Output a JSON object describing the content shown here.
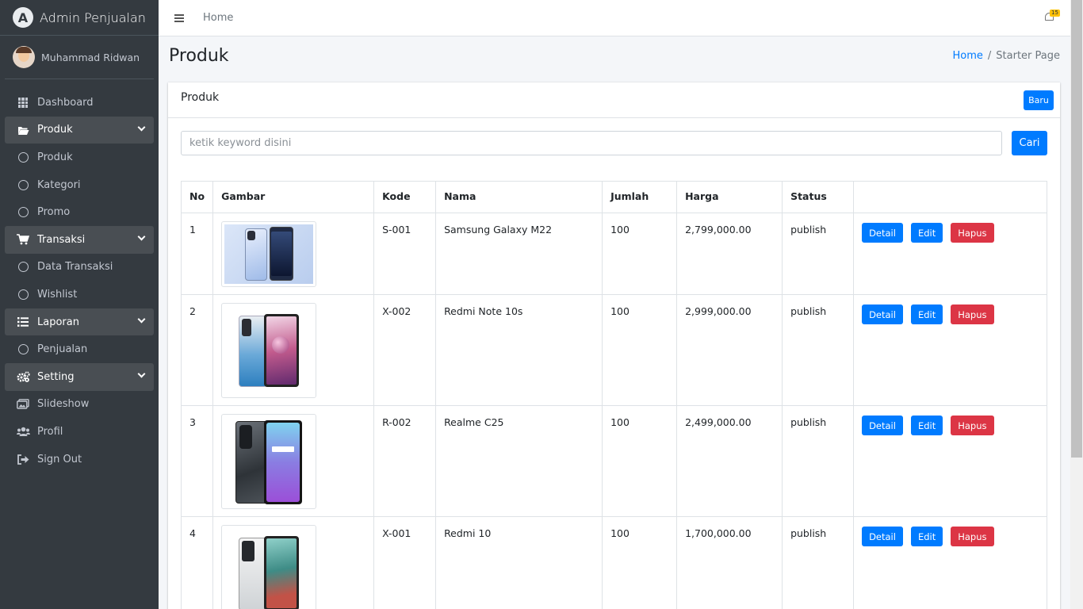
{
  "brand": {
    "name": "Admin Penjualan",
    "logo_letter": "A"
  },
  "user": {
    "name": "Muhammad Ridwan"
  },
  "sidebar": {
    "items": [
      {
        "label": "Dashboard",
        "icon": "grid-icon",
        "active": false,
        "expandable": false
      },
      {
        "label": "Produk",
        "icon": "folder-open-icon",
        "active": true,
        "expandable": true
      },
      {
        "label": "Produk",
        "icon": "circle-icon",
        "active": false,
        "expandable": false
      },
      {
        "label": "Kategori",
        "icon": "circle-icon",
        "active": false,
        "expandable": false
      },
      {
        "label": "Promo",
        "icon": "circle-icon",
        "active": false,
        "expandable": false
      },
      {
        "label": "Transaksi",
        "icon": "cart-icon",
        "active": true,
        "expandable": true
      },
      {
        "label": "Data Transaksi",
        "icon": "circle-icon",
        "active": false,
        "expandable": false
      },
      {
        "label": "Wishlist",
        "icon": "circle-icon",
        "active": false,
        "expandable": false
      },
      {
        "label": "Laporan",
        "icon": "list-icon",
        "active": true,
        "expandable": true
      },
      {
        "label": "Penjualan",
        "icon": "circle-icon",
        "active": false,
        "expandable": false
      },
      {
        "label": "Setting",
        "icon": "gears-icon",
        "active": true,
        "expandable": true
      },
      {
        "label": "Slideshow",
        "icon": "images-icon",
        "active": false,
        "expandable": false
      },
      {
        "label": "Profil",
        "icon": "users-icon",
        "active": false,
        "expandable": false
      },
      {
        "label": "Sign Out",
        "icon": "sign-out-icon",
        "active": false,
        "expandable": false
      }
    ]
  },
  "topbar": {
    "home": "Home",
    "notification_count": "15"
  },
  "header": {
    "title": "Produk",
    "breadcrumb": {
      "home": "Home",
      "current": "Starter Page"
    }
  },
  "card": {
    "title": "Produk",
    "new_button": "Baru",
    "search_placeholder": "ketik keyword disini",
    "search_value": "",
    "search_button": "Cari"
  },
  "table": {
    "columns": [
      "No",
      "Gambar",
      "Kode",
      "Nama",
      "Jumlah",
      "Harga",
      "Status",
      ""
    ],
    "actions": {
      "detail": "Detail",
      "edit": "Edit",
      "delete": "Hapus"
    },
    "rows": [
      {
        "no": "1",
        "image": "samsung-galaxy-m22-image",
        "kode": "S-001",
        "nama": "Samsung Galaxy M22",
        "jumlah": "100",
        "harga": "2,799,000.00",
        "status": "publish"
      },
      {
        "no": "2",
        "image": "redmi-note-10s-image",
        "kode": "X-002",
        "nama": "Redmi Note 10s",
        "jumlah": "100",
        "harga": "2,999,000.00",
        "status": "publish"
      },
      {
        "no": "3",
        "image": "realme-c25-image",
        "kode": "R-002",
        "nama": "Realme C25",
        "jumlah": "100",
        "harga": "2,499,000.00",
        "status": "publish"
      },
      {
        "no": "4",
        "image": "redmi-10-image",
        "kode": "X-001",
        "nama": "Redmi 10",
        "jumlah": "100",
        "harga": "1,700,000.00",
        "status": "publish"
      }
    ]
  },
  "colors": {
    "sidebar_bg": "#343a40",
    "primary": "#007bff",
    "danger": "#dc3545",
    "badge": "#ffc107"
  }
}
